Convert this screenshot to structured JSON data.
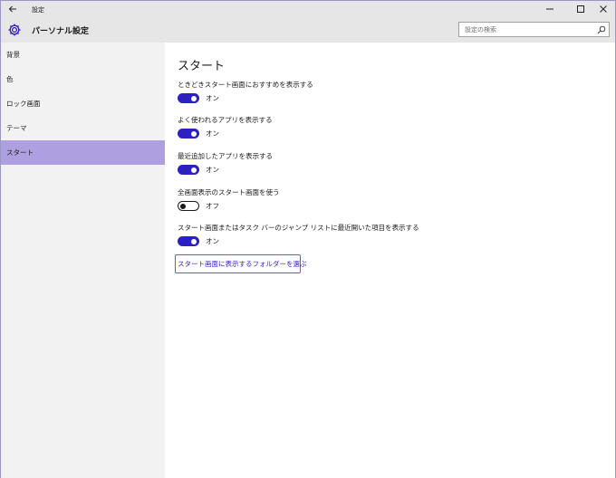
{
  "window": {
    "title": "設定",
    "back_icon": "back-arrow-icon",
    "minimize_icon": "minimize-icon",
    "maximize_icon": "maximize-icon",
    "close_icon": "close-icon"
  },
  "header": {
    "title": "パーソナル設定",
    "icon": "gear-icon"
  },
  "search": {
    "placeholder": "設定の検索",
    "icon": "search-icon"
  },
  "sidebar": {
    "selected_color": "#ad9fe0",
    "items": [
      {
        "label": "背景"
      },
      {
        "label": "色"
      },
      {
        "label": "ロック画面"
      },
      {
        "label": "テーマ"
      },
      {
        "label": "スタート",
        "selected": true
      }
    ]
  },
  "main": {
    "heading": "スタート",
    "settings": [
      {
        "label": "ときどきスタート画面におすすめを表示する",
        "state": "オン",
        "on": true
      },
      {
        "label": "よく使われるアプリを表示する",
        "state": "オン",
        "on": true
      },
      {
        "label": "最近追加したアプリを表示する",
        "state": "オン",
        "on": true
      },
      {
        "label": "全画面表示のスタート画面を使う",
        "state": "オフ",
        "on": false
      },
      {
        "label": "スタート画面またはタスク バーのジャンプ リストに最近開いた項目を表示する",
        "state": "オン",
        "on": true
      }
    ],
    "link": "スタート画面に表示するフォルダーを選ぶ"
  },
  "colors": {
    "accent": "#2c20c0",
    "link": "#3322c8",
    "highlight_border": "#e0317a"
  }
}
